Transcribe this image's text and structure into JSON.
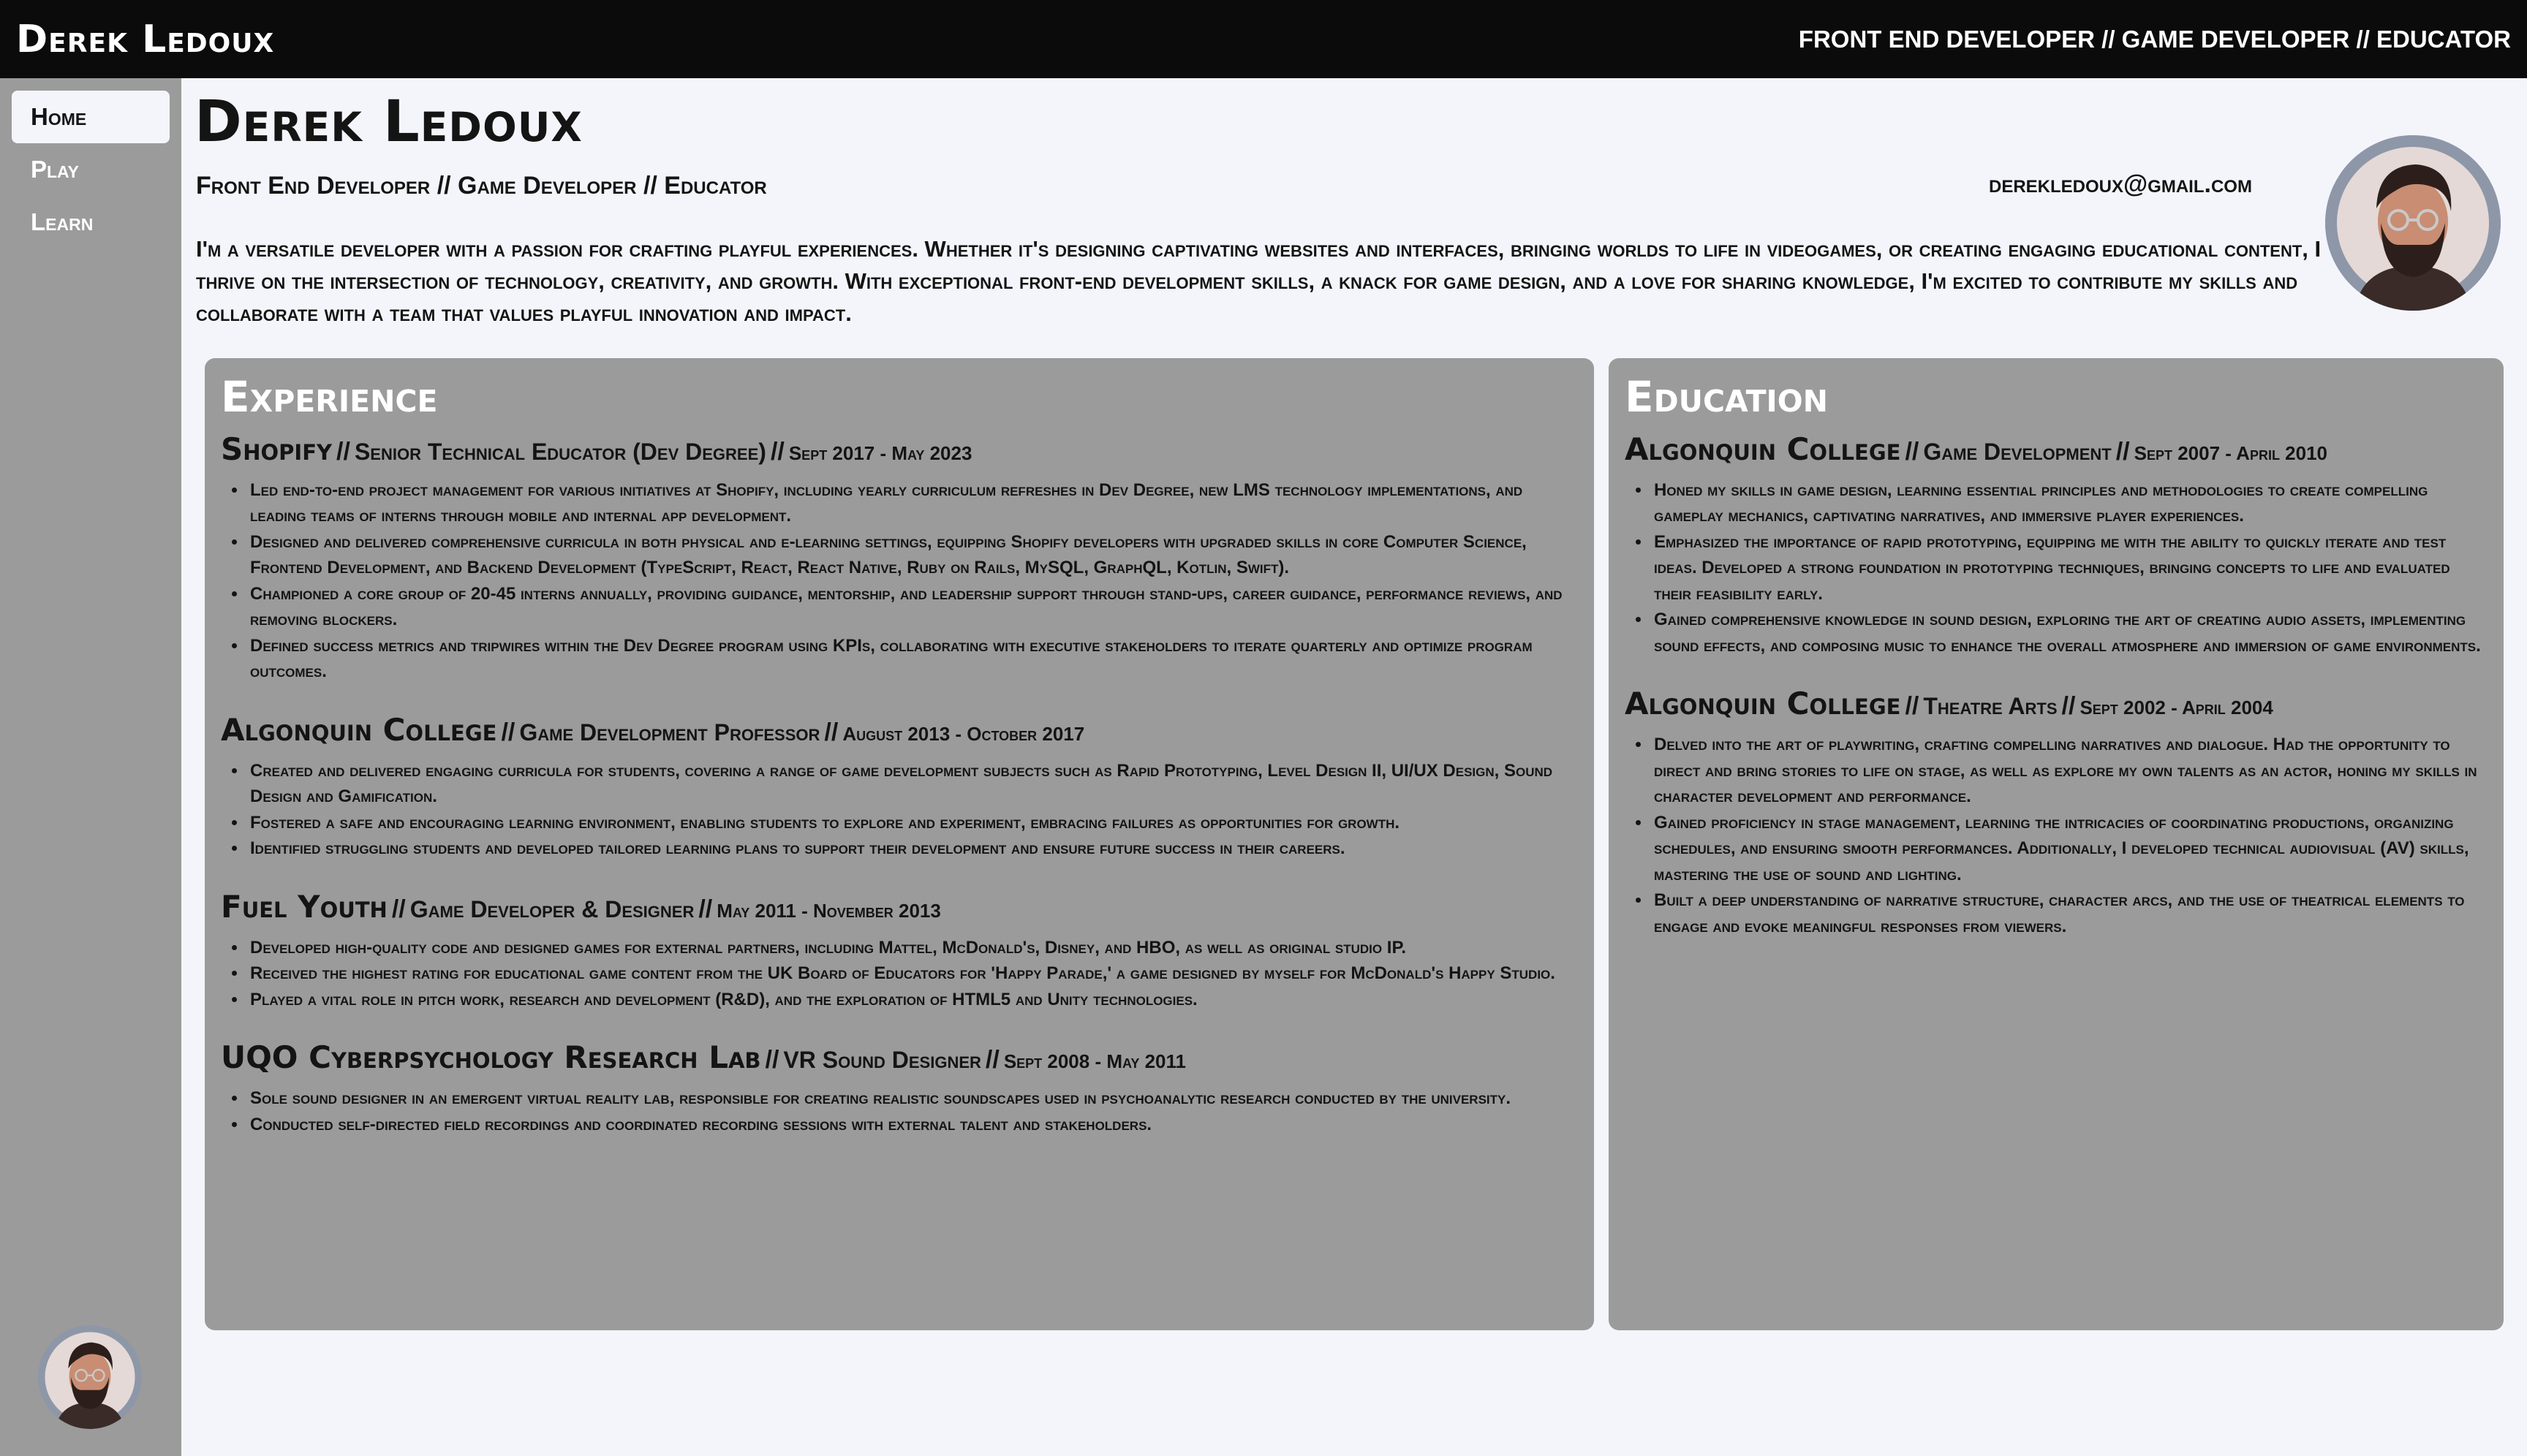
{
  "header": {
    "brand": "Derek Ledoux",
    "tagline": "FRONT END DEVELOPER // GAME DEVELOPER // EDUCATOR"
  },
  "sidebar": {
    "items": [
      {
        "label": "Home",
        "active": true
      },
      {
        "label": "Play",
        "active": false
      },
      {
        "label": "Learn",
        "active": false
      }
    ]
  },
  "profile": {
    "name": "Derek Ledoux",
    "subtitle": "Front End Developer // Game Developer // Educator",
    "email": "derekledoux@gmail.com",
    "intro": "I'm a versatile developer with a passion for crafting playful experiences. Whether it's designing captivating websites and interfaces, bringing worlds to life in videogames, or creating engaging educational content, I thrive on the intersection of technology, creativity, and growth. With exceptional front-end development skills, a knack for game design, and a love for sharing knowledge, I'm excited to contribute my skills and collaborate with a team that values playful innovation and impact."
  },
  "experience": {
    "title": "Experience",
    "entries": [
      {
        "org": "Shopify",
        "role": "Senior Technical Educator (Dev Degree)",
        "dates": "Sept 2017 - May 2023",
        "bullets": [
          "Led end-to-end project management for various initiatives at Shopify, including yearly curriculum refreshes in Dev Degree, new LMS technology implementations, and leading teams of interns through mobile and internal app development.",
          "Designed and delivered comprehensive curricula in both physical and e-learning settings, equipping Shopify developers with upgraded skills in core Computer Science, Frontend Development, and Backend Development (TypeScript, React, React Native, Ruby on Rails, MySQL, GraphQL, Kotlin, Swift).",
          "Championed a core group of 20-45 interns annually, providing guidance, mentorship, and leadership support through stand-ups, career guidance, performance reviews, and removing blockers.",
          "Defined success metrics and tripwires within the Dev Degree program using KPIs, collaborating with executive stakeholders to iterate quarterly and optimize program outcomes."
        ]
      },
      {
        "org": "Algonquin College",
        "role": "Game Development Professor",
        "dates": "August 2013 - October 2017",
        "bullets": [
          "Created and delivered engaging curricula for students, covering a range of game development subjects such as Rapid Prototyping, Level Design II, UI/UX Design, Sound Design and Gamification.",
          "Fostered a safe and encouraging learning environment, enabling students to explore and experiment, embracing failures as opportunities for growth.",
          "Identified struggling students and developed tailored learning plans to support their development and ensure future success in their careers."
        ]
      },
      {
        "org": "Fuel Youth",
        "role": "Game Developer & Designer",
        "dates": "May 2011 - November 2013",
        "bullets": [
          "Developed high-quality code and designed games for external partners, including Mattel, McDonald's, Disney, and HBO, as well as original studio IP.",
          "Received the highest rating for educational game content from the UK Board of Educators for 'Happy Parade,' a game designed by myself for McDonald's Happy Studio.",
          "Played a vital role in pitch work, research and development (R&D), and the exploration of HTML5 and Unity technologies."
        ]
      },
      {
        "org": "UQO Cyberpsychology Research Lab",
        "role": "VR Sound Designer",
        "dates": "Sept 2008 - May 2011",
        "bullets": [
          "Sole sound designer in an emergent virtual reality lab, responsible for creating realistic soundscapes used in psychoanalytic research conducted by the university.",
          "Conducted self-directed field recordings and coordinated recording sessions with external talent and stakeholders."
        ]
      }
    ]
  },
  "education": {
    "title": "Education",
    "entries": [
      {
        "org": "Algonquin College",
        "role": "Game Development",
        "dates": "Sept 2007 - April 2010",
        "bullets": [
          "Honed my skills in game design, learning essential principles and methodologies to create compelling gameplay mechanics, captivating narratives, and immersive player experiences.",
          "Emphasized the importance of rapid prototyping, equipping me with the ability to quickly iterate and test ideas. Developed a strong foundation in prototyping techniques, bringing concepts to life and evaluated their feasibility early.",
          "Gained comprehensive knowledge in sound design, exploring the art of creating audio assets, implementing sound effects, and composing music to enhance the overall atmosphere and immersion of game environments."
        ]
      },
      {
        "org": "Algonquin College",
        "role": "Theatre Arts",
        "dates": "Sept 2002 - April 2004",
        "bullets": [
          "Delved into the art of playwriting, crafting compelling narratives and dialogue. Had the opportunity to direct and bring stories to life on stage, as well as explore my own talents as an actor, honing my skills in character development and performance.",
          "Gained proficiency in stage management, learning the intricacies of coordinating productions, organizing schedules, and ensuring smooth performances. Additionally, I developed technical audiovisual (AV) skills, mastering the use of sound and lighting.",
          "Built a deep understanding of narrative structure, character arcs, and the use of theatrical elements to engage and evoke meaningful responses from viewers."
        ]
      }
    ]
  },
  "colors": {
    "topbar": "#0b0b0b",
    "background": "#f4f5fb",
    "panel": "#9b9b9b",
    "avatar_ring": "#8e97a8"
  }
}
